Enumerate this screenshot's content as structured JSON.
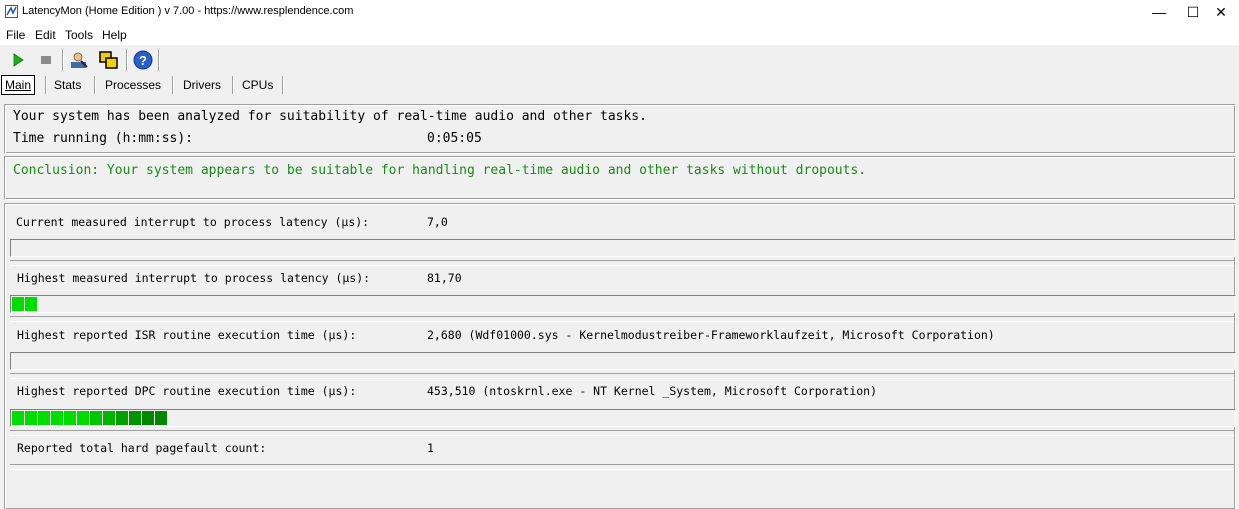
{
  "window": {
    "title": "LatencyMon  (Home Edition )  v 7.00 - https://www.resplendence.com",
    "minimize": "—",
    "maximize": "☐",
    "close": "✕"
  },
  "menu": {
    "items": [
      {
        "label": "File"
      },
      {
        "label": "Edit"
      },
      {
        "label": "Tools"
      },
      {
        "label": "Help"
      }
    ]
  },
  "toolbar": {
    "icons": [
      "play-icon",
      "stop-icon",
      "user-icon",
      "copy-windows-icon",
      "help-icon"
    ]
  },
  "tabs": [
    {
      "label": "Main",
      "active": true
    },
    {
      "label": "Stats",
      "active": false
    },
    {
      "label": "Processes",
      "active": false
    },
    {
      "label": "Drivers",
      "active": false
    },
    {
      "label": "CPUs",
      "active": false
    }
  ],
  "summary": {
    "analyzed": "Your system has been analyzed for suitability of real-time audio and other tasks.",
    "time_label": "Time running (h:mm:ss):",
    "time_value": "0:05:05"
  },
  "conclusion": "Conclusion: Your system appears to be suitable for handling real-time audio and other tasks without dropouts.",
  "metrics": [
    {
      "label": "Current measured interrupt to process latency (µs):",
      "value": "7,0",
      "bar_fraction": 0.0
    },
    {
      "label": "Highest measured interrupt to process latency (µs):",
      "value": "81,70",
      "bar_fraction": 0.02
    },
    {
      "label": "Highest reported ISR routine execution time (µs):",
      "value": "2,680  (Wdf01000.sys - Kernelmodustreiber-Frameworklaufzeit, Microsoft Corporation)",
      "bar_fraction": 0.0
    },
    {
      "label": "Highest reported DPC routine execution time (µs):",
      "value": "453,510  (ntoskrnl.exe - NT Kernel _System, Microsoft Corporation)",
      "bar_fraction": 0.125
    },
    {
      "label": "Reported total hard pagefault count:",
      "value": "1"
    }
  ],
  "colors": {
    "conclusion_text": "#1a8a1a",
    "bar_bright": "#00dd00",
    "bar_dark": "#008800"
  }
}
